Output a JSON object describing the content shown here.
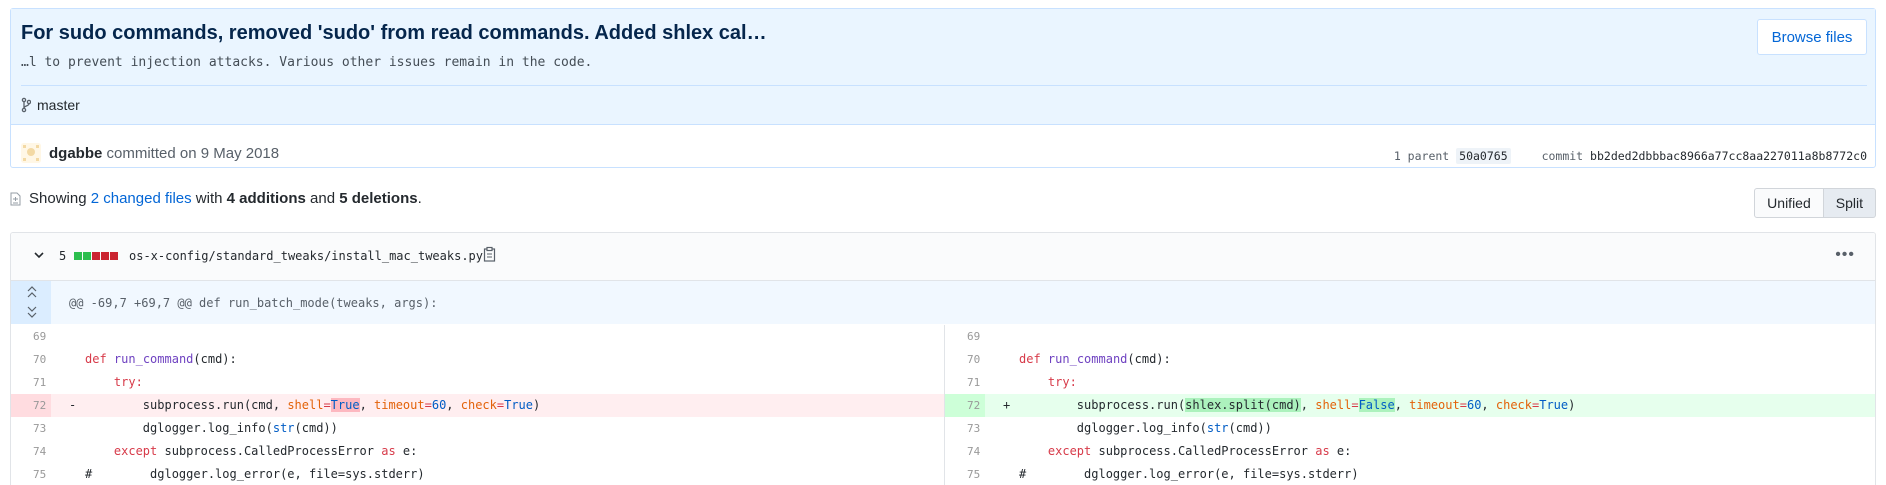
{
  "commit": {
    "title": "For sudo commands, removed 'sudo' from read commands. Added shlex cal…",
    "description": "…l to prevent injection attacks. Various other issues remain in the code.",
    "browse_label": "Browse files",
    "branch": "master",
    "author": "dgabbe",
    "committed_text": "committed on 9 May 2018",
    "parent_label": "1 parent",
    "parent_sha": "50a0765",
    "commit_label": "commit",
    "commit_sha": "bb2ded2dbbbac8966a77cc8aa227011a8b8772c0"
  },
  "toc": {
    "showing": "Showing",
    "changed_files": "2 changed files",
    "with": "with",
    "additions": "4 additions",
    "and": "and",
    "deletions": "5 deletions",
    "period": ".",
    "view_unified": "Unified",
    "view_split": "Split",
    "active_view": "Split"
  },
  "file": {
    "changes": "5",
    "diffstat": [
      "add",
      "add",
      "del",
      "del",
      "del"
    ],
    "path": "os-x-config/standard_tweaks/install_mac_tweaks.py",
    "hunk_header": "@@ -69,7 +69,7 @@ def run_batch_mode(tweaks, args):",
    "rows": [
      {
        "left_ln": "69",
        "right_ln": "69"
      },
      {
        "left_ln": "70",
        "right_ln": "70"
      },
      {
        "left_ln": "71",
        "right_ln": "71"
      },
      {
        "left_ln": "72",
        "right_ln": "72",
        "left_mark": "-",
        "right_mark": "+"
      },
      {
        "left_ln": "73",
        "right_ln": "73"
      },
      {
        "left_ln": "74",
        "right_ln": "74"
      },
      {
        "left_ln": "75",
        "right_ln": "75"
      }
    ],
    "code": {
      "def": "def",
      "run_command": "run_command",
      "cmd_sig": "(cmd):",
      "try": "try:",
      "subprocess_run": "subprocess.run(",
      "cmd": "cmd",
      "shlex_split": "shlex.split(cmd)",
      "comma": ", ",
      "shell": "shell",
      "eq": "=",
      "true": "True",
      "false": "False",
      "timeout": "timeout",
      "sixty": "60",
      "check": "check",
      "close": ")",
      "log_info_pre": "dglogger.log_info(",
      "str": "str",
      "log_info_post": "(cmd))",
      "except": "except",
      "cpe": " subprocess.CalledProcessError ",
      "as": "as",
      "e": " e:",
      "comment_hash": "#",
      "log_error": "dglogger.log_error(e, file=sys.stderr)"
    }
  },
  "colors": {
    "accent": "#0366d6",
    "add_bg": "#e6ffed",
    "del_bg": "#ffeef0",
    "diffstat_add": "#2cbe4e",
    "diffstat_del": "#cb2431"
  }
}
